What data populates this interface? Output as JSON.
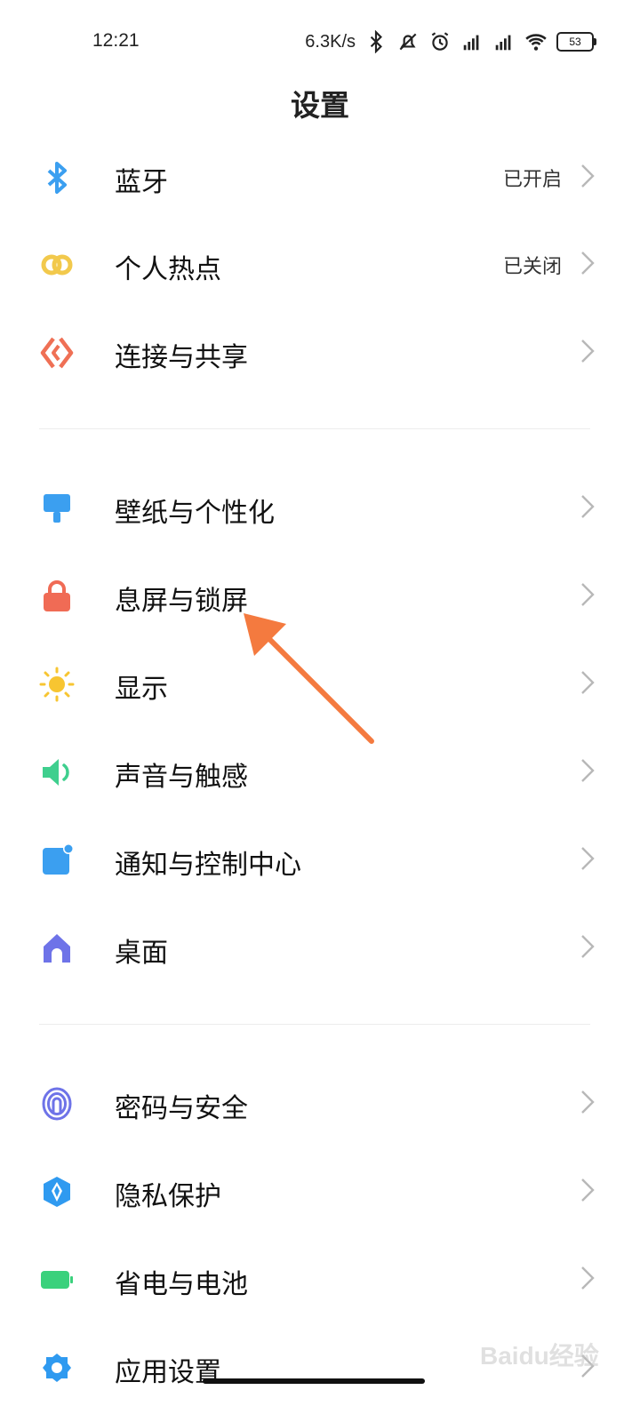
{
  "status_bar": {
    "time": "12:21",
    "net_speed": "6.3K/s",
    "battery": "53"
  },
  "title": "设置",
  "colors": {
    "bluetooth": "#3b9ff0",
    "hotspot": "#f2c94c",
    "connection": "#ef7055",
    "wallpaper": "#3b9ff0",
    "lock": "#f06b55",
    "display": "#f7c531",
    "sound": "#3fcf8e",
    "notification": "#3b9ff0",
    "home": "#6e73e8",
    "password": "#6e73e8",
    "privacy": "#2f9af0",
    "battery": "#3ad17c",
    "apps": "#2f9af0",
    "annotation_arrow": "#f47a3f"
  },
  "groups": [
    [
      {
        "icon": "bluetooth-icon",
        "label": "蓝牙",
        "value": "已开启"
      },
      {
        "icon": "hotspot-icon",
        "label": "个人热点",
        "value": "已关闭"
      },
      {
        "icon": "connection-share-icon",
        "label": "连接与共享",
        "value": ""
      }
    ],
    [
      {
        "icon": "wallpaper-icon",
        "label": "壁纸与个性化",
        "value": ""
      },
      {
        "icon": "lock-icon",
        "label": "息屏与锁屏",
        "value": ""
      },
      {
        "icon": "sun-icon",
        "label": "显示",
        "value": ""
      },
      {
        "icon": "speaker-icon",
        "label": "声音与触感",
        "value": ""
      },
      {
        "icon": "notification-icon",
        "label": "通知与控制中心",
        "value": ""
      },
      {
        "icon": "home-icon",
        "label": "桌面",
        "value": ""
      }
    ],
    [
      {
        "icon": "fingerprint-icon",
        "label": "密码与安全",
        "value": ""
      },
      {
        "icon": "privacy-shield-icon",
        "label": "隐私保护",
        "value": ""
      },
      {
        "icon": "battery-icon",
        "label": "省电与电池",
        "value": ""
      },
      {
        "icon": "apps-gear-icon",
        "label": "应用设置",
        "value": ""
      }
    ]
  ],
  "watermark": "Baidu经验"
}
